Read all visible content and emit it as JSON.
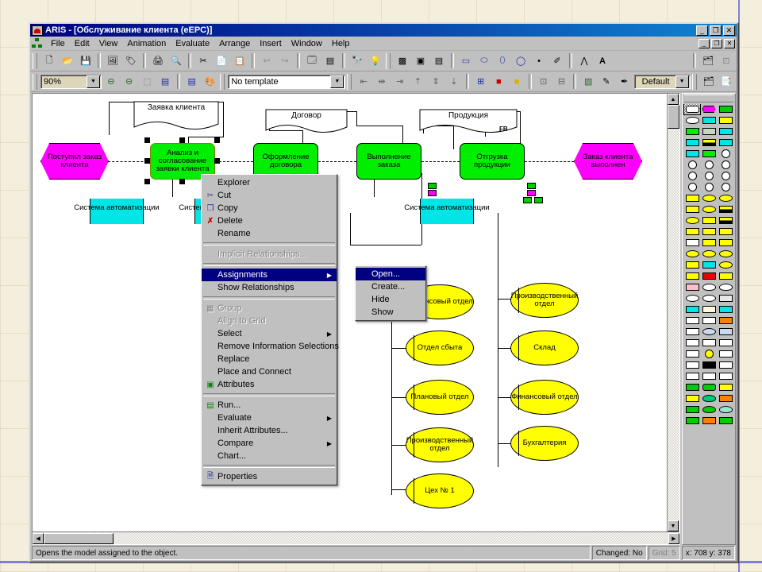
{
  "window": {
    "title": "ARIS - [Обслуживание клиента (eEPC)]",
    "minimize": "_",
    "restore": "❐",
    "close": "✕"
  },
  "menubar": {
    "items": [
      {
        "label": "File"
      },
      {
        "label": "Edit"
      },
      {
        "label": "View"
      },
      {
        "label": "Animation"
      },
      {
        "label": "Evaluate"
      },
      {
        "label": "Arrange"
      },
      {
        "label": "Insert"
      },
      {
        "label": "Window"
      },
      {
        "label": "Help"
      }
    ]
  },
  "toolbar_main": {
    "buttons": [
      {
        "name": "new-icon",
        "glyph": "🗋"
      },
      {
        "name": "open-icon",
        "glyph": "📂"
      },
      {
        "name": "save-icon",
        "glyph": "💾"
      },
      {
        "name": "model-icon",
        "glyph": "🖼"
      },
      {
        "name": "attributes-icon",
        "glyph": "🏷"
      },
      {
        "name": "print-icon",
        "glyph": "🖨"
      },
      {
        "name": "print-preview-icon",
        "glyph": "🔍"
      },
      {
        "name": "cut-icon",
        "glyph": "✂"
      },
      {
        "name": "copy-icon",
        "glyph": "📄"
      },
      {
        "name": "paste-icon",
        "glyph": "📋"
      },
      {
        "name": "undo-icon",
        "glyph": "↩"
      },
      {
        "name": "redo-icon",
        "glyph": "↪"
      },
      {
        "name": "properties-icon",
        "glyph": "🗔"
      },
      {
        "name": "run-icon",
        "glyph": "▤"
      },
      {
        "name": "find-icon",
        "glyph": "🔭"
      },
      {
        "name": "hint-icon",
        "glyph": "💡"
      },
      {
        "name": "place-connect-icon",
        "glyph": "▩"
      },
      {
        "name": "object-a-icon",
        "glyph": "▣"
      },
      {
        "name": "object-b-icon",
        "glyph": "▤"
      },
      {
        "name": "rect-tool-icon",
        "glyph": "▭"
      },
      {
        "name": "ellipse-tool-icon",
        "glyph": "⬭"
      },
      {
        "name": "oval-tool-icon",
        "glyph": "⬯"
      },
      {
        "name": "circle-tool-icon",
        "glyph": "◯"
      },
      {
        "name": "point-tool-icon",
        "glyph": "•"
      },
      {
        "name": "freehand-tool-icon",
        "glyph": "✐"
      },
      {
        "name": "polyline-tool-icon",
        "glyph": "⋀"
      },
      {
        "name": "text-tool-icon",
        "glyph": "A"
      }
    ]
  },
  "toolbar_view": {
    "zoom_value": "90%",
    "template_value": "No template",
    "style_value": "Default",
    "buttons": [
      {
        "name": "zoom-out-icon",
        "glyph": "⊖"
      },
      {
        "name": "zoom-in-icon",
        "glyph": "⊖"
      },
      {
        "name": "zoom-region-icon",
        "glyph": "⬚"
      },
      {
        "name": "fit-page-icon",
        "glyph": "▤"
      },
      {
        "name": "model-attributes-icon",
        "glyph": "▤"
      },
      {
        "name": "colors-icon",
        "glyph": "🎨"
      },
      {
        "name": "align-left-icon",
        "glyph": "⇤"
      },
      {
        "name": "align-center-icon",
        "glyph": "⇹"
      },
      {
        "name": "align-right-icon",
        "glyph": "⇥"
      },
      {
        "name": "align-top-icon",
        "glyph": "⇡"
      },
      {
        "name": "align-middle-icon",
        "glyph": "⇕"
      },
      {
        "name": "align-bottom-icon",
        "glyph": "⇣"
      },
      {
        "name": "distribute-icon",
        "glyph": "⊞"
      },
      {
        "name": "fill-red-icon",
        "glyph": "■"
      },
      {
        "name": "fill-yellow-icon",
        "glyph": "■"
      },
      {
        "name": "group-icon",
        "glyph": "⊡"
      },
      {
        "name": "ungroup-icon",
        "glyph": "⊟"
      },
      {
        "name": "layer-icon",
        "glyph": "▧"
      },
      {
        "name": "pen-color-icon",
        "glyph": "✎"
      },
      {
        "name": "line-style-icon",
        "glyph": "✒"
      },
      {
        "name": "assign-model-icon",
        "glyph": "🗂"
      },
      {
        "name": "open-assigned-icon",
        "glyph": "📑"
      }
    ]
  },
  "context_menu": {
    "items": [
      {
        "label": "Explorer",
        "icon": "",
        "state": "normal",
        "arrow": false
      },
      {
        "label": "Cut",
        "icon": "cut-icon",
        "state": "normal",
        "arrow": false
      },
      {
        "label": "Copy",
        "icon": "copy-icon",
        "state": "normal",
        "arrow": false
      },
      {
        "label": "Delete",
        "icon": "delete-icon",
        "state": "normal",
        "arrow": false
      },
      {
        "label": "Rename",
        "icon": "",
        "state": "normal",
        "arrow": false
      },
      {
        "label": "---",
        "icon": "",
        "state": "sep",
        "arrow": false
      },
      {
        "label": "Implicit Relationships...",
        "icon": "",
        "state": "disabled",
        "arrow": false
      },
      {
        "label": "---",
        "icon": "",
        "state": "sep",
        "arrow": false
      },
      {
        "label": "Assignments",
        "icon": "",
        "state": "highlight",
        "arrow": true
      },
      {
        "label": "Show Relationships",
        "icon": "",
        "state": "normal",
        "arrow": false
      },
      {
        "label": "---",
        "icon": "",
        "state": "sep",
        "arrow": false
      },
      {
        "label": "Group",
        "icon": "group-icon",
        "state": "disabled",
        "arrow": false
      },
      {
        "label": "Align to Grid",
        "icon": "",
        "state": "disabled",
        "arrow": false
      },
      {
        "label": "Select",
        "icon": "",
        "state": "normal",
        "arrow": true
      },
      {
        "label": "Remove Information Selections",
        "icon": "",
        "state": "normal",
        "arrow": false
      },
      {
        "label": "Replace",
        "icon": "",
        "state": "normal",
        "arrow": false
      },
      {
        "label": "Place and Connect",
        "icon": "",
        "state": "normal",
        "arrow": false
      },
      {
        "label": "Attributes",
        "icon": "attributes-icon",
        "state": "normal",
        "arrow": false
      },
      {
        "label": "---",
        "icon": "",
        "state": "sep",
        "arrow": false
      },
      {
        "label": "Run...",
        "icon": "run-icon",
        "state": "normal",
        "arrow": false
      },
      {
        "label": "Evaluate",
        "icon": "",
        "state": "normal",
        "arrow": true
      },
      {
        "label": "Inherit Attributes...",
        "icon": "",
        "state": "normal",
        "arrow": false
      },
      {
        "label": "Compare",
        "icon": "",
        "state": "normal",
        "arrow": true
      },
      {
        "label": "Chart...",
        "icon": "",
        "state": "normal",
        "arrow": false
      },
      {
        "label": "---",
        "icon": "",
        "state": "sep",
        "arrow": false
      },
      {
        "label": "Properties",
        "icon": "properties-icon",
        "state": "normal",
        "arrow": false
      }
    ]
  },
  "submenu": {
    "items": [
      {
        "label": "Open...",
        "state": "highlight"
      },
      {
        "label": "Create...",
        "state": "normal"
      },
      {
        "label": "Hide",
        "state": "normal"
      },
      {
        "label": "Show",
        "state": "normal"
      }
    ]
  },
  "statusbar": {
    "hint": "Opens the model assigned to the object.",
    "changed": "Changed: No",
    "grid": "Grid: 5",
    "coords": "x: 708 y: 378"
  },
  "diagram": {
    "events": [
      {
        "label": "Поступил заказ клиента"
      },
      {
        "label": "Заказ клиента выполнен"
      }
    ],
    "functions": [
      {
        "label": "Анализ и согласование заявки клиента",
        "selected": true
      },
      {
        "label": "Оформление договора",
        "selected": false
      },
      {
        "label": "Выполнение заказа",
        "selected": false
      },
      {
        "label": "Отгрузка продукции",
        "selected": false
      }
    ],
    "documents": [
      {
        "label": "Заявка клиента"
      },
      {
        "label": "Договор"
      },
      {
        "label": "Продукция"
      }
    ],
    "systems": [
      {
        "label": "Система автоматизации"
      },
      {
        "label": "Система автоматизации"
      },
      {
        "label": "Система автоматизации"
      }
    ],
    "annotation": "FB",
    "org_units_left": [
      {
        "label": "Финансовый отдел"
      },
      {
        "label": "Отдел сбыта"
      },
      {
        "label": "Плановый отдел"
      },
      {
        "label": "Производственный отдел"
      },
      {
        "label": "Цех № 1"
      }
    ],
    "org_units_right": [
      {
        "label": "Производственный отдел"
      },
      {
        "label": "Склад"
      },
      {
        "label": "Финансовый отдел"
      },
      {
        "label": "Бухгалтерия"
      }
    ]
  },
  "palette": {
    "cells": [
      {
        "shape": "rr",
        "color": "#ffffff",
        "selected": true
      },
      {
        "shape": "hex",
        "color": "#ff00ff",
        "selected": false
      },
      {
        "shape": "rect",
        "color": "#00cc00",
        "selected": false
      },
      {
        "shape": "cloud",
        "color": "#ffffff",
        "selected": false
      },
      {
        "shape": "rect",
        "color": "#00e5e5",
        "selected": false
      },
      {
        "shape": "rect",
        "color": "#ffff00",
        "selected": false
      },
      {
        "shape": "rect",
        "color": "#00ee00",
        "selected": false
      },
      {
        "shape": "rect",
        "color": "#c8d8c0",
        "selected": false
      },
      {
        "shape": "rect",
        "color": "#00e5e5",
        "selected": false
      },
      {
        "shape": "rect",
        "color": "#00e5e5",
        "selected": false
      },
      {
        "shape": "half",
        "color": "#00e5e5",
        "selected": false
      },
      {
        "shape": "rect",
        "color": "#00e5e5",
        "selected": false
      },
      {
        "shape": "rect",
        "color": "#00e5e5",
        "selected": false
      },
      {
        "shape": "rect",
        "color": "#00ee00",
        "selected": false
      },
      {
        "shape": "circ",
        "color": "#ffffff",
        "selected": false
      },
      {
        "shape": "circ",
        "color": "#ffffff",
        "selected": false
      },
      {
        "shape": "circ",
        "color": "#ffffff",
        "selected": false
      },
      {
        "shape": "circ",
        "color": "#ffffff",
        "selected": false
      },
      {
        "shape": "circ",
        "color": "#ffffff",
        "selected": false
      },
      {
        "shape": "circ",
        "color": "#ffffff",
        "selected": false
      },
      {
        "shape": "circ",
        "color": "#ffffff",
        "selected": false
      },
      {
        "shape": "circ",
        "color": "#ffffff",
        "selected": false
      },
      {
        "shape": "circ",
        "color": "#ffffff",
        "selected": false
      },
      {
        "shape": "circ",
        "color": "#ffffff",
        "selected": false
      },
      {
        "shape": "rect",
        "color": "#ffff00",
        "selected": false
      },
      {
        "shape": "ell",
        "color": "#ffff00",
        "selected": false
      },
      {
        "shape": "ell",
        "color": "#ffff00",
        "selected": false
      },
      {
        "shape": "rect",
        "color": "#ffff00",
        "selected": false
      },
      {
        "shape": "ell",
        "color": "#ffff00",
        "selected": false
      },
      {
        "shape": "half",
        "color": "#ffff00",
        "selected": false
      },
      {
        "shape": "ell",
        "color": "#ffff00",
        "selected": false
      },
      {
        "shape": "rect",
        "color": "#ffff00",
        "selected": false
      },
      {
        "shape": "half",
        "color": "#ffff00",
        "selected": false
      },
      {
        "shape": "rect",
        "color": "#ffff00",
        "selected": false
      },
      {
        "shape": "rect",
        "color": "#ffff00",
        "selected": false
      },
      {
        "shape": "rect",
        "color": "#ffff00",
        "selected": false
      },
      {
        "shape": "rect",
        "color": "#ffffff",
        "selected": false
      },
      {
        "shape": "rect",
        "color": "#ffff00",
        "selected": false
      },
      {
        "shape": "rect",
        "color": "#ffff00",
        "selected": false
      },
      {
        "shape": "ell",
        "color": "#ffff00",
        "selected": false
      },
      {
        "shape": "ell",
        "color": "#ffff00",
        "selected": false
      },
      {
        "shape": "ell",
        "color": "#ffff00",
        "selected": false
      },
      {
        "shape": "rect",
        "color": "#ffff00",
        "selected": false
      },
      {
        "shape": "rect",
        "color": "#00e5e5",
        "selected": false
      },
      {
        "shape": "ell",
        "color": "#ffff00",
        "selected": false
      },
      {
        "shape": "rect",
        "color": "#ffff00",
        "selected": false
      },
      {
        "shape": "rect",
        "color": "#ee0000",
        "selected": false
      },
      {
        "shape": "rect",
        "color": "#ffff00",
        "selected": false
      },
      {
        "shape": "rect",
        "color": "#ffc0cb",
        "selected": false
      },
      {
        "shape": "cloud",
        "color": "#ffffff",
        "selected": false
      },
      {
        "shape": "cloud",
        "color": "#ffffff",
        "selected": false
      },
      {
        "shape": "ell",
        "color": "#ffffff",
        "selected": false
      },
      {
        "shape": "ell",
        "color": "#ffffff",
        "selected": false
      },
      {
        "shape": "rect",
        "color": "#e8e8e8",
        "selected": false
      },
      {
        "shape": "rect",
        "color": "#00e5e5",
        "selected": false
      },
      {
        "shape": "rect",
        "color": "#fff8dc",
        "selected": false
      },
      {
        "shape": "rect",
        "color": "#00e5e5",
        "selected": false
      },
      {
        "shape": "rect",
        "color": "#ffffff",
        "selected": false
      },
      {
        "shape": "rect",
        "color": "#ffffff",
        "selected": false
      },
      {
        "shape": "rect",
        "color": "#ff8000",
        "selected": false
      },
      {
        "shape": "rect",
        "color": "#ffffff",
        "selected": false
      },
      {
        "shape": "ell",
        "color": "#ccd8f0",
        "selected": false
      },
      {
        "shape": "rect",
        "color": "#ccd8f0",
        "selected": false
      },
      {
        "shape": "rect",
        "color": "#ffffff",
        "selected": false
      },
      {
        "shape": "rect",
        "color": "#ffffff",
        "selected": false
      },
      {
        "shape": "rect",
        "color": "#ffffff",
        "selected": false
      },
      {
        "shape": "rect",
        "color": "#ffffff",
        "selected": false
      },
      {
        "shape": "circ",
        "color": "#ffff00",
        "selected": false
      },
      {
        "shape": "rect",
        "color": "#ffffff",
        "selected": false
      },
      {
        "shape": "rect",
        "color": "#ffffff",
        "selected": false
      },
      {
        "shape": "rect",
        "color": "#000000",
        "selected": false
      },
      {
        "shape": "rect",
        "color": "#ffffff",
        "selected": false
      },
      {
        "shape": "rect",
        "color": "#ffffff",
        "selected": false
      },
      {
        "shape": "rect",
        "color": "#ffffff",
        "selected": false
      },
      {
        "shape": "rect",
        "color": "#ffffff",
        "selected": false
      },
      {
        "shape": "rect",
        "color": "#00cc00",
        "selected": false
      },
      {
        "shape": "rr",
        "color": "#00cc00",
        "selected": false
      },
      {
        "shape": "rect",
        "color": "#ffff00",
        "selected": false
      },
      {
        "shape": "rect",
        "color": "#ffff00",
        "selected": false
      },
      {
        "shape": "cloud",
        "color": "#00cc77",
        "selected": false
      },
      {
        "shape": "rect",
        "color": "#ff8000",
        "selected": false
      },
      {
        "shape": "rect",
        "color": "#00cc00",
        "selected": false
      },
      {
        "shape": "cloud",
        "color": "#00cc00",
        "selected": false
      },
      {
        "shape": "cloud",
        "color": "#99e5d5",
        "selected": false
      },
      {
        "shape": "rect",
        "color": "#00cc00",
        "selected": false
      },
      {
        "shape": "rect",
        "color": "#ff8000",
        "selected": false
      },
      {
        "shape": "rect",
        "color": "#00cc00",
        "selected": false
      }
    ]
  }
}
